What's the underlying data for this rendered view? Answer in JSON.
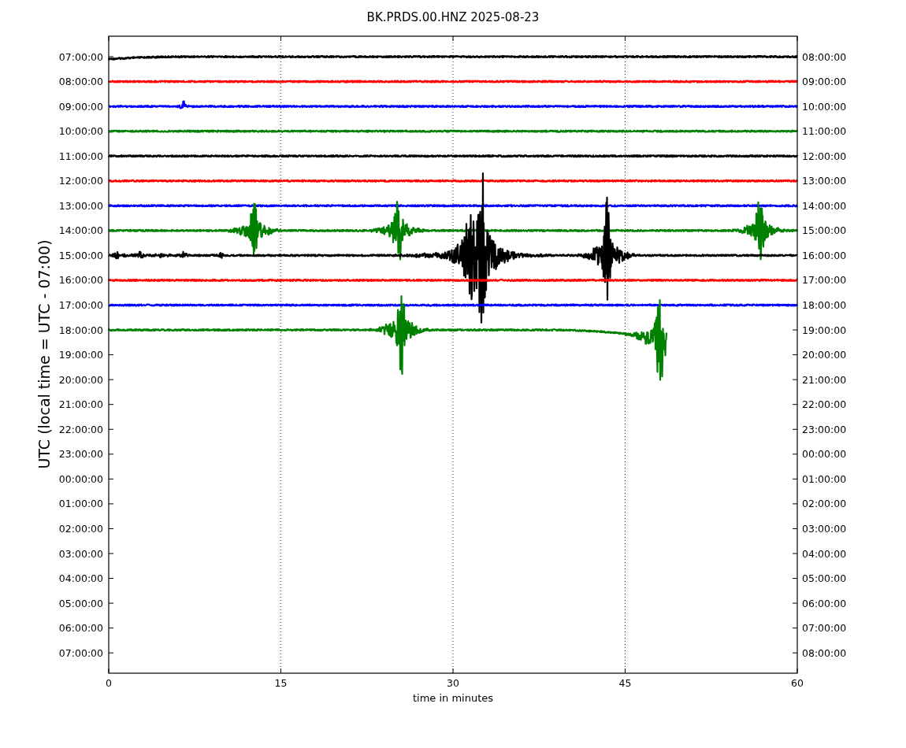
{
  "title": "BK.PRDS.00.HNZ 2025-08-23",
  "ylabel": "UTC (local time = UTC - 07:00)",
  "xlabel": "time in minutes",
  "xticks": [
    "0",
    "15",
    "30",
    "45",
    "60"
  ],
  "left_ticks": [
    "07:00:00",
    "08:00:00",
    "09:00:00",
    "10:00:00",
    "11:00:00",
    "12:00:00",
    "13:00:00",
    "14:00:00",
    "15:00:00",
    "16:00:00",
    "17:00:00",
    "18:00:00",
    "19:00:00",
    "20:00:00",
    "21:00:00",
    "22:00:00",
    "23:00:00",
    "00:00:00",
    "01:00:00",
    "02:00:00",
    "03:00:00",
    "04:00:00",
    "05:00:00",
    "06:00:00",
    "07:00:00"
  ],
  "right_ticks": [
    "08:00:00",
    "09:00:00",
    "10:00:00",
    "11:00:00",
    "12:00:00",
    "13:00:00",
    "14:00:00",
    "15:00:00",
    "16:00:00",
    "17:00:00",
    "18:00:00",
    "19:00:00",
    "20:00:00",
    "21:00:00",
    "22:00:00",
    "23:00:00",
    "00:00:00",
    "01:00:00",
    "02:00:00",
    "03:00:00",
    "04:00:00",
    "05:00:00",
    "06:00:00",
    "07:00:00",
    "08:00:00"
  ],
  "traces": [
    {
      "color": "#000000"
    },
    {
      "color": "#ff0000"
    },
    {
      "color": "#0000ff"
    },
    {
      "color": "#008000"
    },
    {
      "color": "#000000"
    },
    {
      "color": "#ff0000"
    },
    {
      "color": "#0000ff"
    },
    {
      "color": "#008000"
    },
    {
      "color": "#000000"
    },
    {
      "color": "#ff0000"
    },
    {
      "color": "#0000ff"
    },
    {
      "color": "#008000"
    }
  ]
}
